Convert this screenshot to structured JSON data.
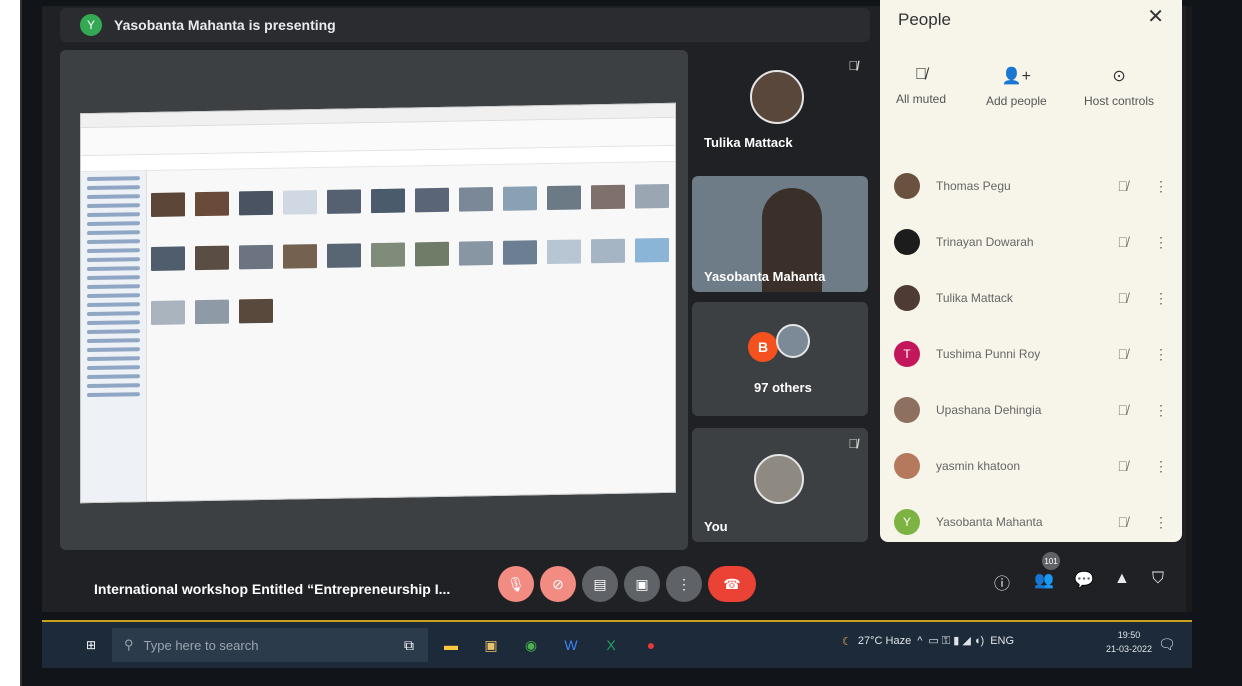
{
  "meet": {
    "presenting_initial": "Y",
    "presenting_text": "Yasobanta Mahanta is presenting",
    "meeting_title": "International workshop Entitled “Entrepreneurship I...",
    "participant_count_badge": "101"
  },
  "tiles": {
    "tulika": "Tulika Mattack",
    "yasobanta": "Yasobanta Mahanta",
    "others_initial": "B",
    "others_label": "97 others",
    "you": "You"
  },
  "people_panel": {
    "title": "People",
    "actions": [
      {
        "label": "All muted",
        "icon": "mic-off-icon"
      },
      {
        "label": "Add people",
        "icon": "add-person-icon"
      },
      {
        "label": "Host controls",
        "icon": "toggle-icon"
      }
    ],
    "participants": [
      {
        "name": "Thomas Pegu",
        "avatar_color": "#6b5140",
        "initial": ""
      },
      {
        "name": "Trinayan Dowarah",
        "avatar_color": "#1c1c1c",
        "initial": ""
      },
      {
        "name": "Tulika Mattack",
        "avatar_color": "#4d3b34",
        "initial": ""
      },
      {
        "name": "Tushima Punni Roy",
        "avatar_color": "#c2185b",
        "initial": "T"
      },
      {
        "name": "Upashana Dehingia",
        "avatar_color": "#8e7061",
        "initial": ""
      },
      {
        "name": "yasmin khatoon",
        "avatar_color": "#b57a5e",
        "initial": ""
      },
      {
        "name": "Yasobanta Mahanta",
        "avatar_color": "#7cb342",
        "initial": "Y"
      }
    ]
  },
  "taskbar": {
    "search_placeholder": "Type here to search",
    "weather": "27°C  Haze",
    "lang": "ENG",
    "time": "19:50",
    "date": "21-03-2022"
  },
  "colors": {
    "meet_dark": "#202124",
    "end_call": "#ea4335",
    "control_red": "#f28b82",
    "panel_bg": "#f7f4e9"
  }
}
